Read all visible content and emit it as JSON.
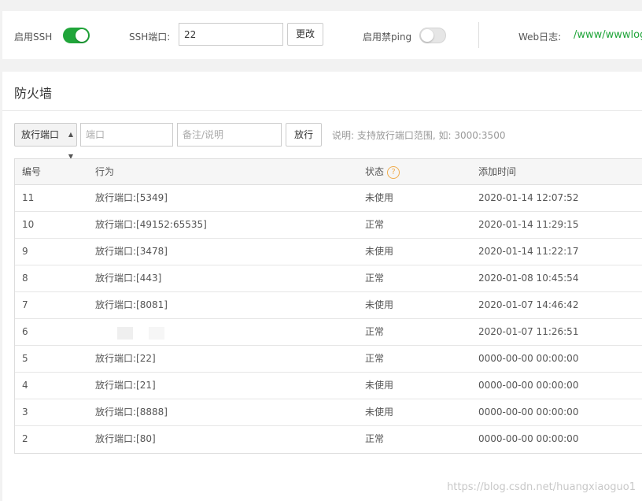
{
  "topbar": {
    "ssh_label": "启用SSH",
    "ssh_enabled": true,
    "port_label": "SSH端口:",
    "port_value": "22",
    "change_button": "更改",
    "ping_label": "启用禁ping",
    "ping_enabled": false,
    "weblog_label": "Web日志:",
    "weblog_path": "/www/wwwlog"
  },
  "firewall": {
    "title": "防火墙",
    "select_value": "放行端口",
    "port_placeholder": "端口",
    "remark_placeholder": "备注/说明",
    "submit_button": "放行",
    "note": "说明: 支持放行端口范围, 如: 3000:3500"
  },
  "table": {
    "headers": {
      "id": "编号",
      "action": "行为",
      "status": "状态",
      "time": "添加时间"
    },
    "status_help_icon": "question-icon",
    "rows": [
      {
        "id": "11",
        "action": "放行端口:[5349]",
        "status": "未使用",
        "time": "2020-01-14 12:07:52"
      },
      {
        "id": "10",
        "action": "放行端口:[49152:65535]",
        "status": "正常",
        "time": "2020-01-14 11:29:15"
      },
      {
        "id": "9",
        "action": "放行端口:[3478]",
        "status": "未使用",
        "time": "2020-01-14 11:22:17"
      },
      {
        "id": "8",
        "action": "放行端口:[443]",
        "status": "正常",
        "time": "2020-01-08 10:45:54"
      },
      {
        "id": "7",
        "action": "放行端口:[8081]",
        "status": "未使用",
        "time": "2020-01-07 14:46:42"
      },
      {
        "id": "6",
        "action": "",
        "status": "正常",
        "time": "2020-01-07 11:26:51"
      },
      {
        "id": "5",
        "action": "放行端口:[22]",
        "status": "正常",
        "time": "0000-00-00 00:00:00"
      },
      {
        "id": "4",
        "action": "放行端口:[21]",
        "status": "未使用",
        "time": "0000-00-00 00:00:00"
      },
      {
        "id": "3",
        "action": "放行端口:[8888]",
        "status": "未使用",
        "time": "0000-00-00 00:00:00"
      },
      {
        "id": "2",
        "action": "放行端口:[80]",
        "status": "正常",
        "time": "0000-00-00 00:00:00"
      }
    ]
  },
  "watermark": "https://blog.csdn.net/huangxiaoguo1",
  "colors": {
    "accent": "#20a53a",
    "help": "#f0ad4e"
  }
}
